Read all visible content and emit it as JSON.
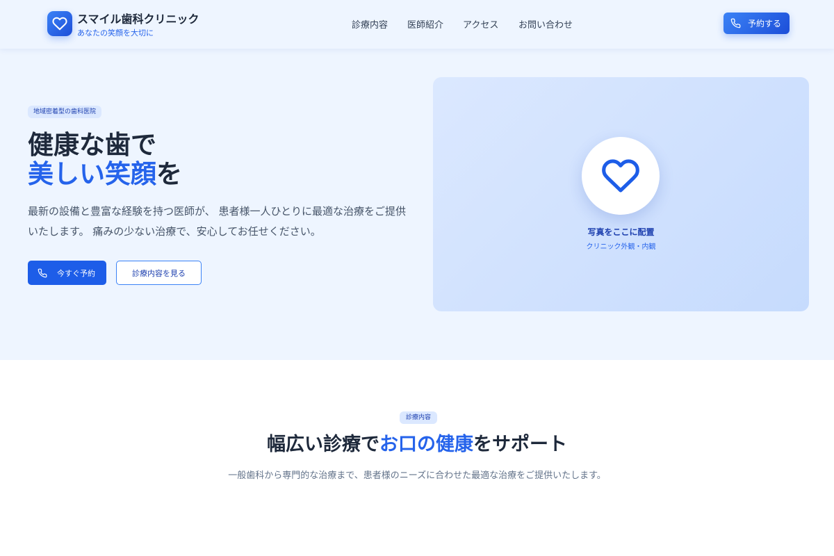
{
  "header": {
    "brand_name": "スマイル歯科クリニック",
    "brand_tagline": "あなたの笑顔を大切に",
    "nav": [
      {
        "label": "診療内容"
      },
      {
        "label": "医師紹介"
      },
      {
        "label": "アクセス"
      },
      {
        "label": "お問い合わせ"
      }
    ],
    "reserve_label": "予約する"
  },
  "hero": {
    "badge": "地域密着型の歯科医院",
    "title_line1": "健康な歯で",
    "title_line2_accent": "美しい笑顔",
    "title_line2_rest": "を",
    "description": "最新の設備と豊富な経験を持つ医師が、 患者様一人ひとりに最適な治療をご提供いたします。 痛みの少ない治療で、安心してお任せください。",
    "primary_button": "今すぐ予約",
    "secondary_button": "診療内容を見る",
    "photo_caption": "写真をここに配置",
    "photo_subcaption": "クリニック外観・内観"
  },
  "services": {
    "badge": "診療内容",
    "title_prefix": "幅広い診療で",
    "title_accent": "お口の健康",
    "title_suffix": "をサポート",
    "description": "一般歯科から専門的な治療まで、患者様のニーズに合わせた最適な治療をご提供いたします。"
  },
  "icons": {
    "logo": "heart-icon",
    "reserve": "phone-icon",
    "hero_primary": "phone-icon",
    "photo": "heart-icon"
  },
  "colors": {
    "accent": "#2563eb",
    "accent_dark": "#1d4ed8",
    "hero_background": "#eef5ff",
    "text_primary": "#1e293b",
    "text_secondary": "#475569"
  }
}
